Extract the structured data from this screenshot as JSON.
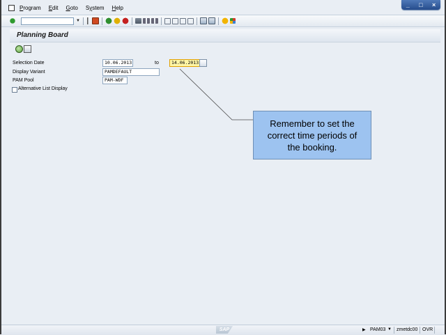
{
  "window": {
    "controls": [
      "_",
      "□",
      "×"
    ]
  },
  "menu": {
    "items": [
      {
        "label": "Program",
        "accel": "P"
      },
      {
        "label": "Edit",
        "accel": "E"
      },
      {
        "label": "Goto",
        "accel": "G"
      },
      {
        "label": "System",
        "accel": "y"
      },
      {
        "label": "Help",
        "accel": "H"
      }
    ]
  },
  "toolbar": {
    "command_field_value": "",
    "icons": [
      "enter-icon",
      "back-icon",
      "save-icon",
      "back-green-icon",
      "exit-icon",
      "cancel-icon",
      "print-icon",
      "find-icon",
      "find-next-icon",
      "first-page-icon",
      "prev-page-icon",
      "next-page-icon",
      "last-page-icon",
      "create-session-icon",
      "shortcut-icon",
      "help-icon",
      "customize-icon"
    ]
  },
  "page": {
    "title": "Planning Board",
    "app_icons": [
      "execute-icon",
      "get-variant-icon"
    ]
  },
  "form": {
    "selection_date_label": "Selection Date",
    "selection_date_from": "10.06.2013",
    "to_label": "to",
    "selection_date_to": "14.06.2013",
    "display_variant_label": "Display Variant",
    "display_variant_value": "PAMDEFAULT",
    "pam_pool_label": "PAM Pool",
    "pam_pool_value": "PAM-WDF",
    "alt_list_label": "Alternative List Display",
    "alt_list_checked": false
  },
  "callout": {
    "text": "Remember to set the correct time periods of the booking."
  },
  "status": {
    "sap_logo": "SAP",
    "transaction": "PAM03",
    "server": "zmetdc00",
    "mode": "OVR"
  },
  "colors": {
    "callout_bg": "#9dc3f0",
    "required_field_bg": "#fff6a6",
    "screen_bg": "#e9eef4"
  }
}
